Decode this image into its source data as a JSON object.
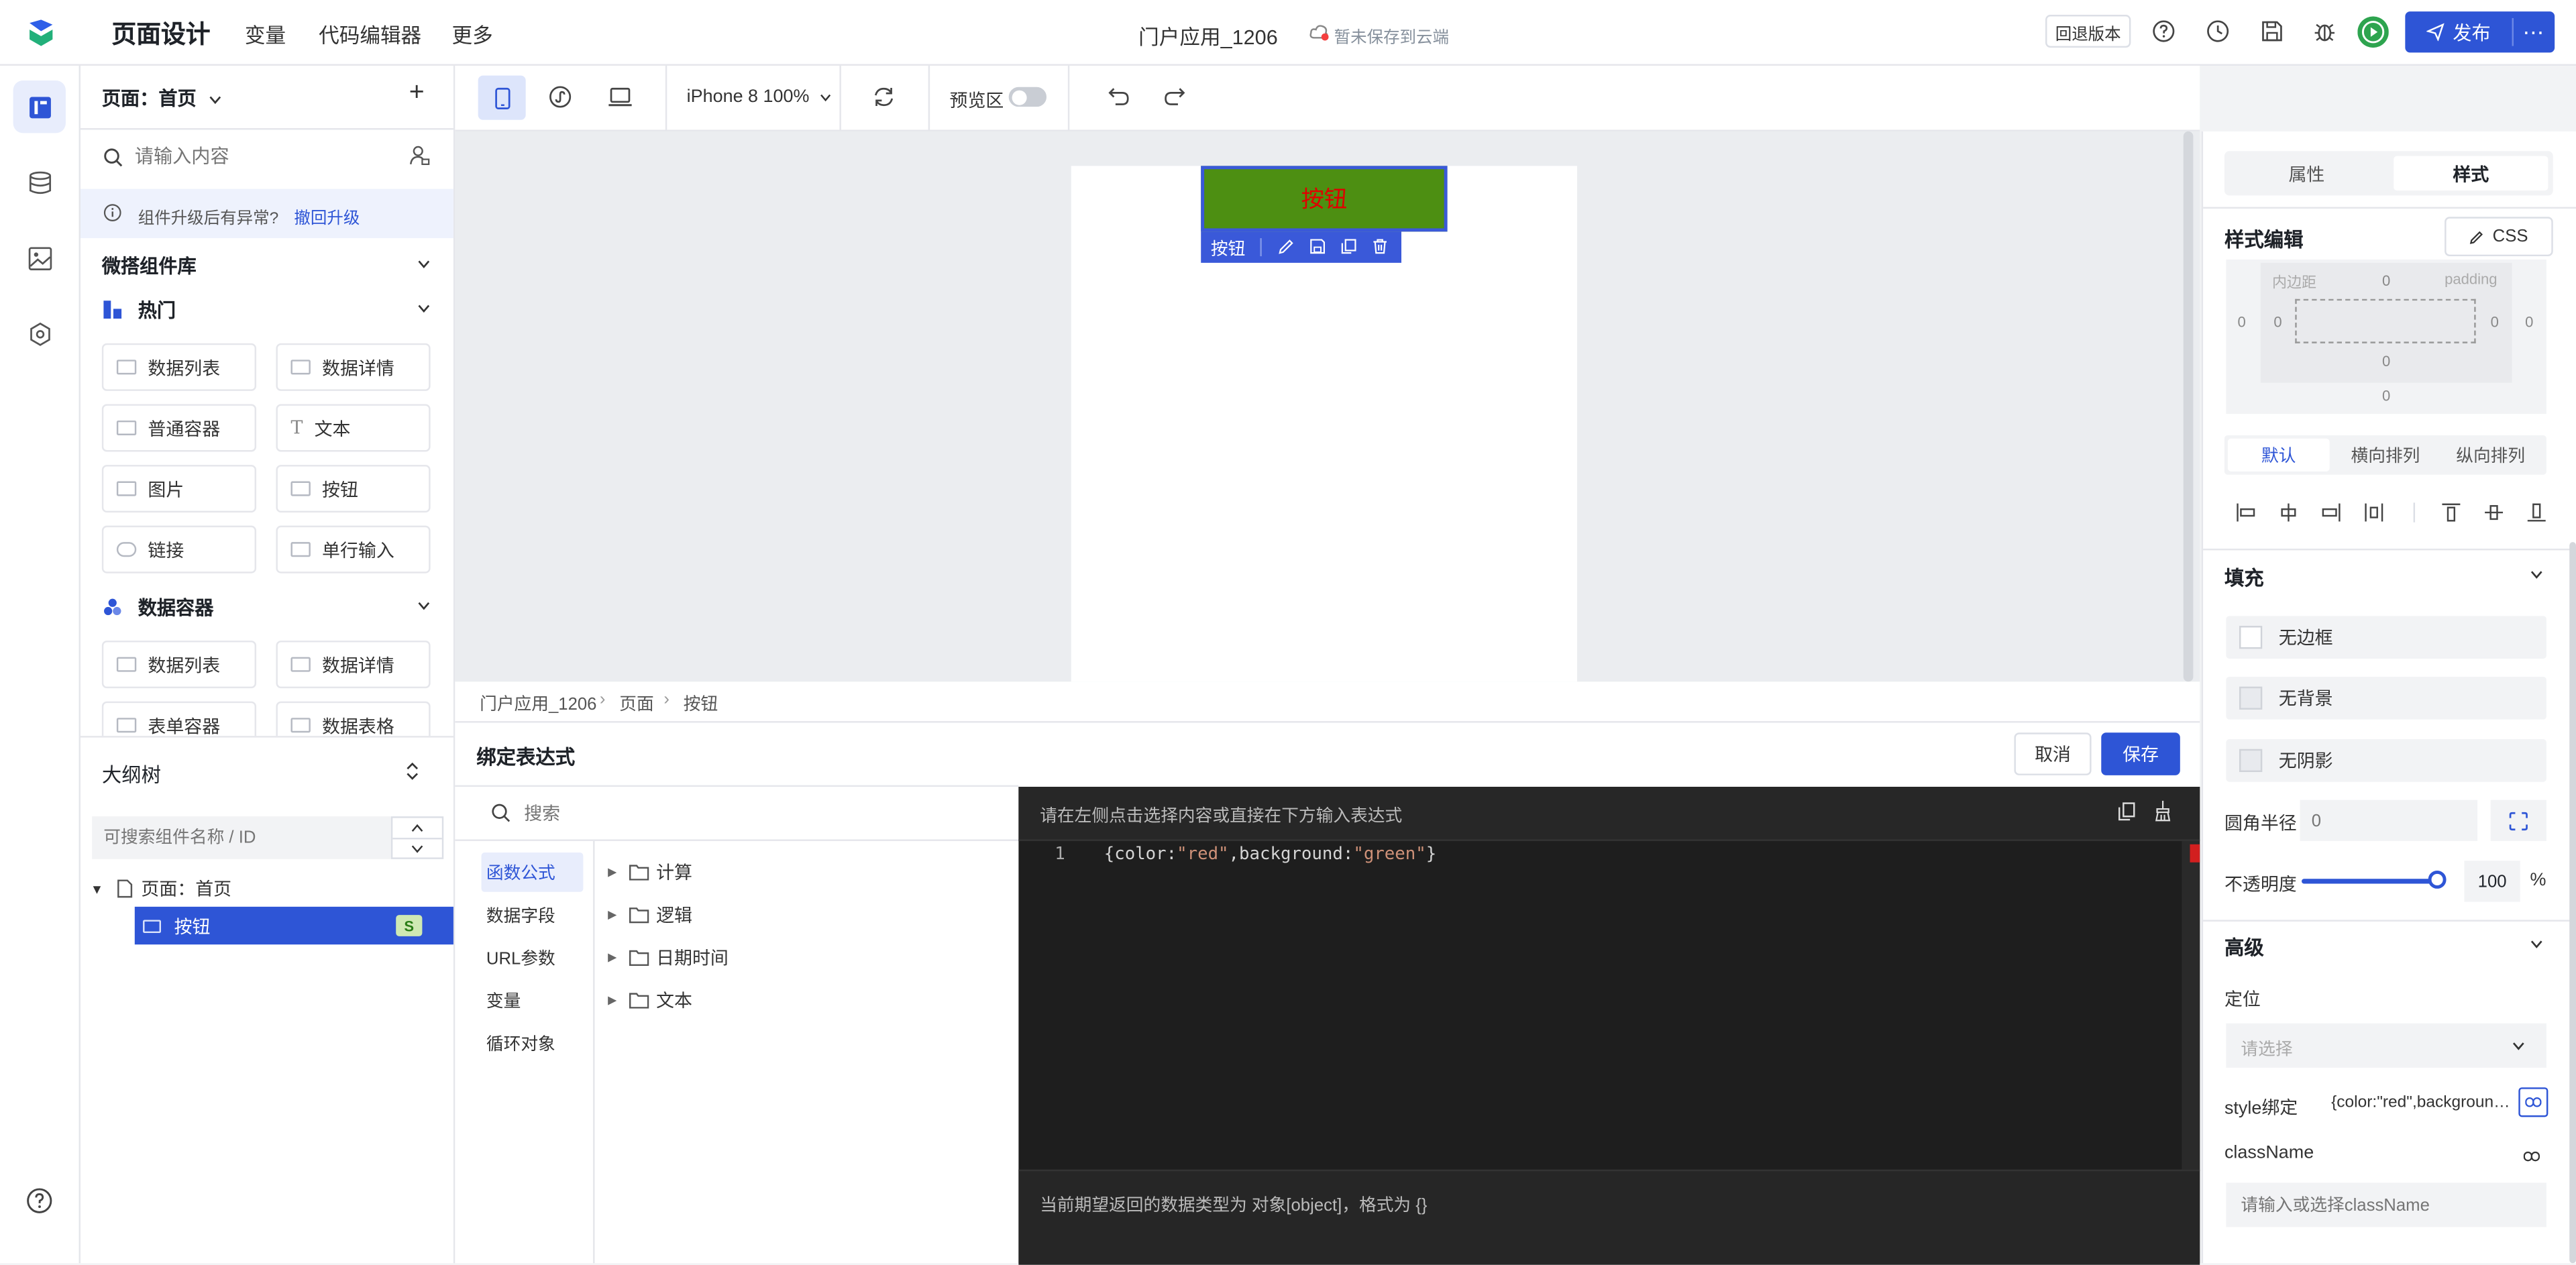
{
  "header": {
    "title": "页面设计",
    "menu": [
      "变量",
      "代码编辑器",
      "更多"
    ],
    "app_name": "门户应用_1206",
    "save_status": "暂未保存到云端",
    "rollback_label": "回退版本",
    "publish_label": "发布"
  },
  "left": {
    "page_select": "页面：首页",
    "search_placeholder": "请输入内容",
    "notice": "组件升级后有异常?",
    "notice_link": "撤回升级",
    "library_title": "微搭组件库",
    "hot_title": "热门",
    "hot_items": [
      "数据列表",
      "数据详情",
      "普通容器",
      "文本",
      "图片",
      "按钮",
      "链接",
      "单行输入"
    ],
    "data_container_title": "数据容器",
    "data_items": [
      "数据列表",
      "数据详情",
      "表单容器",
      "数据表格"
    ],
    "outline_title": "大纲树",
    "outline_search_placeholder": "可搜索组件名称 / ID",
    "tree_page": "页面：首页",
    "tree_button": "按钮",
    "tree_badge": "S"
  },
  "toolbar": {
    "device": "iPhone 8 100%",
    "preview_label": "预览区"
  },
  "canvas": {
    "button_text": "按钮",
    "selection_label": "按钮",
    "button_bg": "#4d8f12",
    "button_text_color": "#e00000",
    "accent": "#3a59d9"
  },
  "bottom": {
    "breadcrumb": [
      "门户应用_1206",
      "页面",
      "按钮"
    ],
    "title": "绑定表达式",
    "cancel_label": "取消",
    "save_label": "保存",
    "search_placeholder": "搜索",
    "categories": [
      "函数公式",
      "数据字段",
      "URL参数",
      "变量",
      "循环对象"
    ],
    "folders": [
      "计算",
      "逻辑",
      "日期时间",
      "文本"
    ],
    "editor_hint": "请在左侧点击选择内容或直接在下方输入表达式",
    "line_number": "1",
    "code": {
      "open": "{",
      "k1": "color",
      "c1": ":",
      "v1": "\"red\"",
      "comma": ",",
      "k2": "background",
      "c2": ":",
      "v2": "\"green\"",
      "close": "}"
    },
    "footer_hint": "当前期望返回的数据类型为 对象[object]，格式为 {}"
  },
  "right": {
    "tabs": [
      "属性",
      "样式"
    ],
    "style_edit_title": "样式编辑",
    "css_label": "CSS",
    "box": {
      "padding_cn": "内边距",
      "padding_en": "padding",
      "values": [
        "0",
        "0",
        "0",
        "0",
        "0",
        "0",
        "0",
        "0"
      ]
    },
    "layout_tabs": [
      "默认",
      "横向排列",
      "纵向排列"
    ],
    "fill_title": "填充",
    "fill_items": [
      "无边框",
      "无背景",
      "无阴影"
    ],
    "radius_label": "圆角半径",
    "radius_placeholder": "0",
    "opacity_label": "不透明度",
    "opacity_value": "100",
    "opacity_unit": "%",
    "opacity_fraction": 1.0,
    "advanced_title": "高级",
    "position_label": "定位",
    "position_placeholder": "请选择",
    "style_bind_label": "style绑定",
    "style_bind_value": "{color:\"red\",background:\"green\"}",
    "classname_label": "className",
    "classname_placeholder": "请输入或选择className"
  }
}
